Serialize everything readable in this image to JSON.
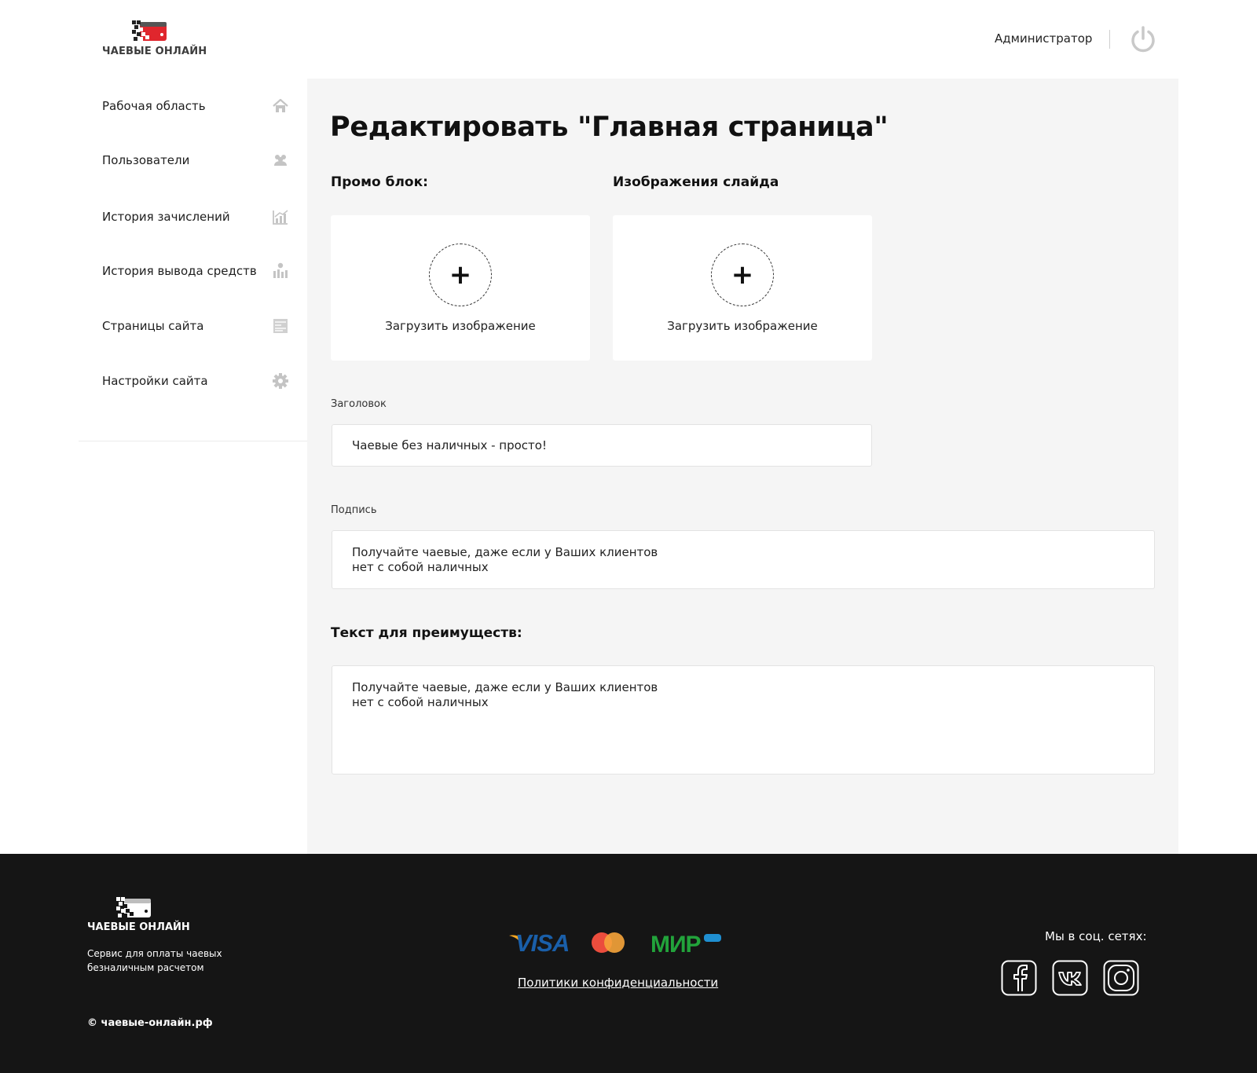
{
  "header": {
    "logo_text": "ЧАЕВЫЕ ОНЛАЙН",
    "user_name": "Администратор",
    "logout_icon": "power-icon"
  },
  "sidebar": {
    "items": [
      {
        "label": "Рабочая область",
        "icon": "home-icon"
      },
      {
        "label": "Пользователи",
        "icon": "users-icon"
      },
      {
        "label": "История зачислений",
        "icon": "chart-icon"
      },
      {
        "label": "История вывода средств",
        "icon": "money-chart-icon"
      },
      {
        "label": "Страницы сайта",
        "icon": "pages-icon"
      },
      {
        "label": "Настройки сайта",
        "icon": "gear-icon"
      }
    ]
  },
  "main": {
    "title": "Редактировать \"Главная страница\"",
    "promo_label": "Промо блок:",
    "slide_label": "Изображения слайда",
    "upload_caption": "Загрузить изображение",
    "heading_label": "Заголовок",
    "heading_value": "Чаевые без наличных - просто!",
    "caption_label": "Подпись",
    "caption_line1": "Получайте чаевые, даже если у Ваших клиентов",
    "caption_line2": "нет с собой наличных",
    "advantages_label": "Текст для преимуществ:",
    "advantages_line1": "Получайте чаевые, даже если у Ваших клиентов",
    "advantages_line2": "нет с собой наличных"
  },
  "footer": {
    "logo_text": "ЧАЕВЫЕ ОНЛАЙН",
    "desc_line1": "Сервис для оплаты чаевых",
    "desc_line2": "безналичным расчетом",
    "copyright": "© чаевые-онлайн.рф",
    "payments": {
      "visa": "VISA",
      "mir": "МИР"
    },
    "privacy": "Политики конфиденциальности",
    "social_title": "Мы в соц. сетях:"
  },
  "colors": {
    "brand_red": "#e0262d",
    "visa_blue": "#1a5fa9",
    "visa_gold": "#f7a823",
    "mir_green": "#22a33b",
    "mastercard_red": "#eb4d3d",
    "mastercard_orange": "#f6a43a"
  }
}
